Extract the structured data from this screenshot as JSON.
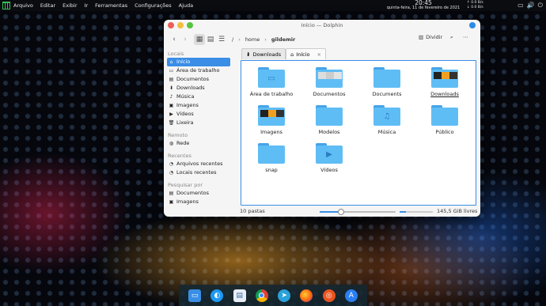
{
  "panel": {
    "menu": [
      "Arquivo",
      "Editar",
      "Exibir",
      "Ir",
      "Ferramentas",
      "Configurações",
      "Ajuda"
    ],
    "time": "20:45",
    "date": "quinta-feira, 11 de fevereiro de 2021",
    "net_up": "0.0 B/s",
    "net_down": "0.0 B/s",
    "tray_icons": [
      "monitor-icon",
      "volume-icon",
      "power-icon"
    ]
  },
  "window": {
    "title": "Início — Dolphin",
    "breadcrumb": [
      "/",
      "home",
      "gildemir"
    ],
    "split_label": "Dividir",
    "tabs": [
      {
        "label": "Downloads",
        "icon": "download-icon"
      },
      {
        "label": "Início",
        "icon": "home-icon"
      }
    ],
    "sidebar": {
      "sections": [
        {
          "title": "Locais",
          "items": [
            "Início",
            "Área de trabalho",
            "Documentos",
            "Downloads",
            "Música",
            "Imagens",
            "Vídeos",
            "Lixeira"
          ]
        },
        {
          "title": "Remoto",
          "items": [
            "Rede"
          ]
        },
        {
          "title": "Recentes",
          "items": [
            "Arquivos recentes",
            "Locais recentes"
          ]
        },
        {
          "title": "Pesquisar por",
          "items": [
            "Documentos",
            "Imagens"
          ]
        }
      ]
    },
    "files": [
      "Área de trabalho",
      "Documentos",
      "Documents",
      "Downloads",
      "Imagens",
      "Modelos",
      "Música",
      "Público",
      "snap",
      "Vídeos"
    ],
    "status": {
      "count": "10 pastas",
      "zoom_fraction": 0.28,
      "free": "145,5 GiB livres",
      "used_fraction": 0.2
    }
  },
  "colors": {
    "accent": "#3a8ee6",
    "folder": "#5fbdf5",
    "manjaro": "#35bf5c"
  },
  "dock": [
    "files-icon",
    "kde-icon",
    "document-icon",
    "chrome-icon",
    "telegram-icon",
    "firefox-icon",
    "ubuntu-icon",
    "appstore-icon"
  ]
}
